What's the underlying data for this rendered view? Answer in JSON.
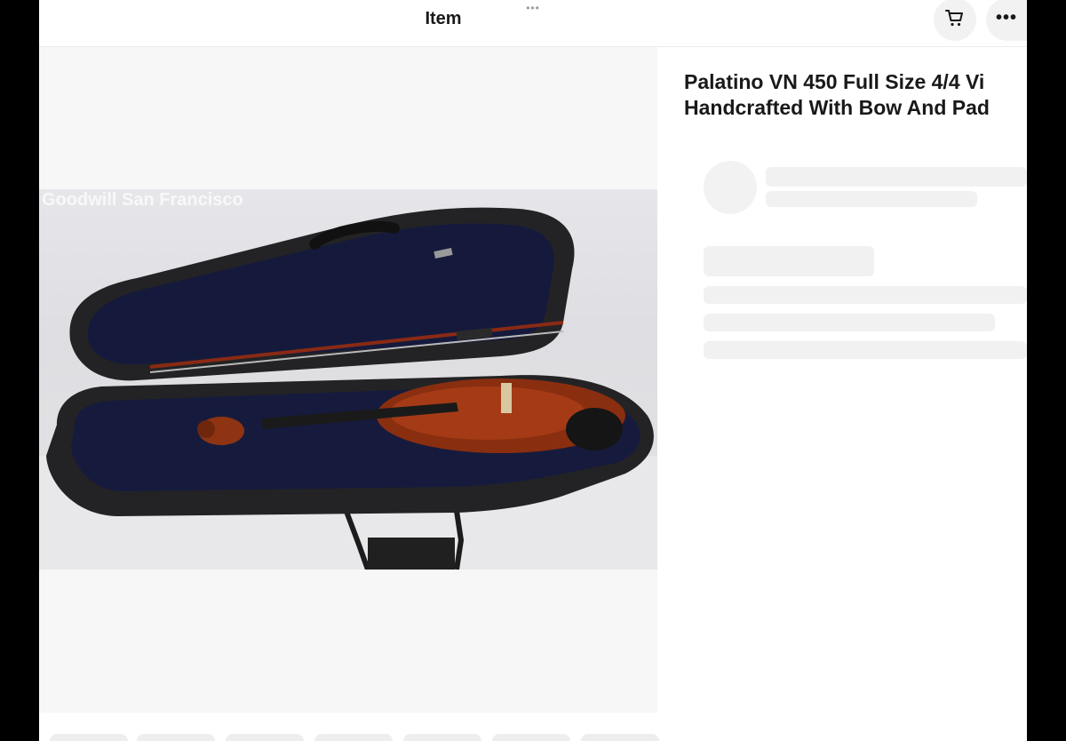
{
  "header": {
    "title": "Item",
    "drag_handle": "•••",
    "cart_icon": "cart-icon",
    "more_label": "•••"
  },
  "gallery": {
    "watermark": "Goodwill San Francisco"
  },
  "product": {
    "title_line1": "Palatino VN 450 Full Size 4/4 Vi",
    "title_line2": "Handcrafted With Bow And Pad"
  },
  "colors": {
    "accent": "#191919",
    "skeleton": "#f1f1f1",
    "background": "#ffffff"
  }
}
